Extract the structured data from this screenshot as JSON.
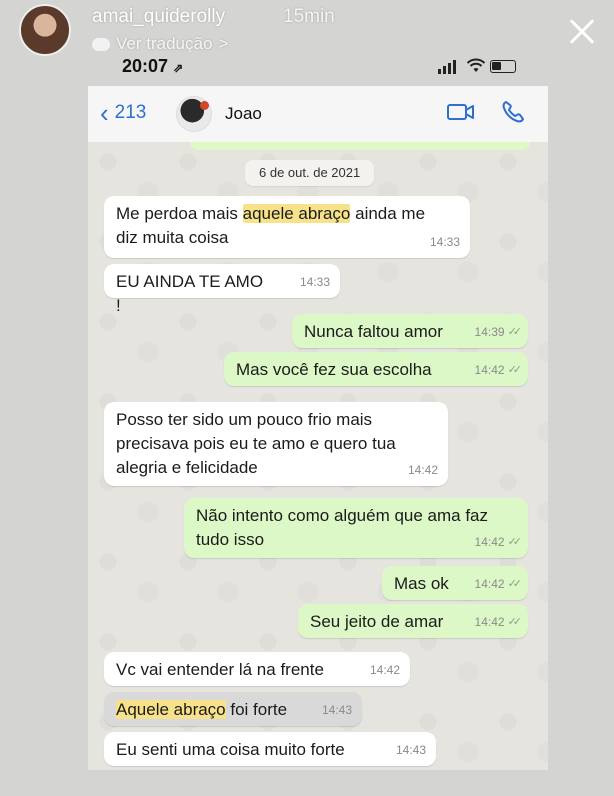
{
  "story": {
    "username": "amai_quiderolly",
    "posted": "15min",
    "translate_label": "Ver tradução",
    "translate_chevron": ">"
  },
  "status_bar": {
    "time": "20:07",
    "location_arrow": "⇗"
  },
  "chat_header": {
    "back_count": "213",
    "contact_name": "Joao"
  },
  "date_separator": "6 de out. de 2021",
  "messages": [
    {
      "dir": "in",
      "parts": [
        "Me perdoa mais ",
        "aquele abraço",
        " ainda me diz muita coisa"
      ],
      "time": "14:33"
    },
    {
      "dir": "in",
      "text": "EU AINDA TE AMO !",
      "time": "14:33"
    },
    {
      "dir": "out",
      "text": "Nunca faltou amor",
      "time": "14:39"
    },
    {
      "dir": "out",
      "text": "Mas você fez sua escolha",
      "time": "14:42"
    },
    {
      "dir": "in",
      "text": "Posso ter sido um pouco frio mais precisava pois eu te amo e quero tua alegria e felicidade",
      "time": "14:42"
    },
    {
      "dir": "out",
      "text": "Não intento como alguém que ama faz tudo isso",
      "time": "14:42"
    },
    {
      "dir": "out",
      "text": "Mas ok",
      "time": "14:42"
    },
    {
      "dir": "out",
      "text": "Seu jeito de amar",
      "time": "14:42"
    },
    {
      "dir": "in",
      "text": "Vc vai entender lá na frente",
      "time": "14:42"
    },
    {
      "dir": "in",
      "parts": [
        "Aquele abraço",
        " foi forte"
      ],
      "time": "14:43"
    },
    {
      "dir": "in",
      "text": "Eu senti uma coisa muito forte",
      "time": "14:43"
    }
  ],
  "colors": {
    "incoming_bubble": "#ffffff",
    "outgoing_bubble": "#dcf8c6",
    "highlight": "#f7e28a",
    "accent": "#2f6fd0"
  },
  "icons": [
    "close-icon",
    "translate-icon",
    "signal-icon",
    "wifi-icon",
    "battery-icon",
    "back-chevron-icon",
    "video-call-icon",
    "phone-call-icon",
    "read-ticks-icon"
  ]
}
